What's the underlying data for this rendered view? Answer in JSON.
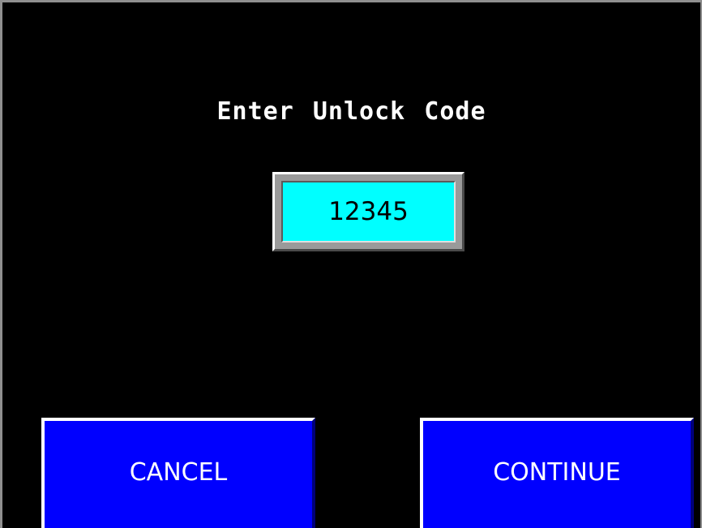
{
  "dialog": {
    "title": "Enter Unlock Code",
    "code_value": "12345"
  },
  "buttons": {
    "cancel_label": "CANCEL",
    "continue_label": "CONTINUE"
  },
  "colors": {
    "background": "#000000",
    "field_fill": "#00ffff",
    "button_fill": "#0000ff",
    "text_on_dark": "#ffffff"
  }
}
